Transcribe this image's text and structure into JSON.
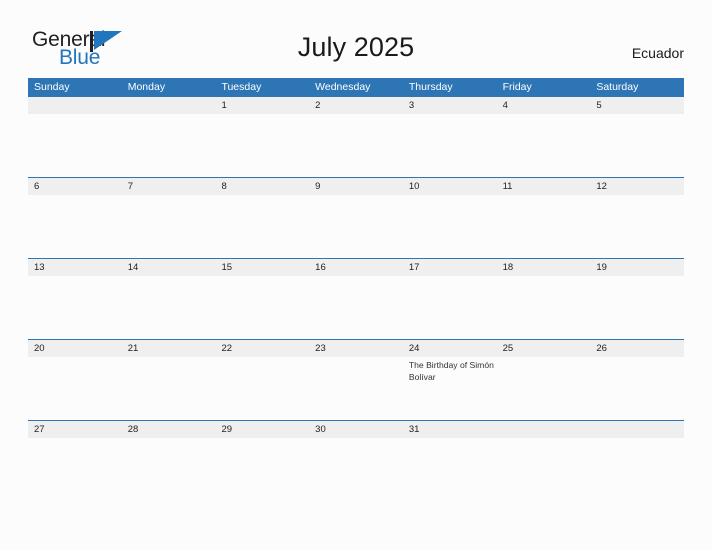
{
  "brand": {
    "name_top": "General",
    "name_bottom": "Blue",
    "flag_icon": "blue-flag-triangle-icon"
  },
  "header": {
    "title": "July 2025",
    "country": "Ecuador"
  },
  "colors": {
    "header_blue": "#2e75b6",
    "date_band_gray": "#efefef",
    "brand_blue": "#2176bd",
    "page_background": "#fcfcfc",
    "text_dark": "#1a1a1a"
  },
  "calendar": {
    "weekdays": [
      "Sunday",
      "Monday",
      "Tuesday",
      "Wednesday",
      "Thursday",
      "Friday",
      "Saturday"
    ],
    "weeks": [
      {
        "days": [
          {
            "num": "",
            "events": []
          },
          {
            "num": "",
            "events": []
          },
          {
            "num": "1",
            "events": []
          },
          {
            "num": "2",
            "events": []
          },
          {
            "num": "3",
            "events": []
          },
          {
            "num": "4",
            "events": []
          },
          {
            "num": "5",
            "events": []
          }
        ]
      },
      {
        "days": [
          {
            "num": "6",
            "events": []
          },
          {
            "num": "7",
            "events": []
          },
          {
            "num": "8",
            "events": []
          },
          {
            "num": "9",
            "events": []
          },
          {
            "num": "10",
            "events": []
          },
          {
            "num": "11",
            "events": []
          },
          {
            "num": "12",
            "events": []
          }
        ]
      },
      {
        "days": [
          {
            "num": "13",
            "events": []
          },
          {
            "num": "14",
            "events": []
          },
          {
            "num": "15",
            "events": []
          },
          {
            "num": "16",
            "events": []
          },
          {
            "num": "17",
            "events": []
          },
          {
            "num": "18",
            "events": []
          },
          {
            "num": "19",
            "events": []
          }
        ]
      },
      {
        "days": [
          {
            "num": "20",
            "events": []
          },
          {
            "num": "21",
            "events": []
          },
          {
            "num": "22",
            "events": []
          },
          {
            "num": "23",
            "events": []
          },
          {
            "num": "24",
            "events": [
              "The Birthday of Simón Bolívar"
            ]
          },
          {
            "num": "25",
            "events": []
          },
          {
            "num": "26",
            "events": []
          }
        ]
      },
      {
        "days": [
          {
            "num": "27",
            "events": []
          },
          {
            "num": "28",
            "events": []
          },
          {
            "num": "29",
            "events": []
          },
          {
            "num": "30",
            "events": []
          },
          {
            "num": "31",
            "events": []
          },
          {
            "num": "",
            "events": []
          },
          {
            "num": "",
            "events": []
          }
        ]
      }
    ]
  }
}
